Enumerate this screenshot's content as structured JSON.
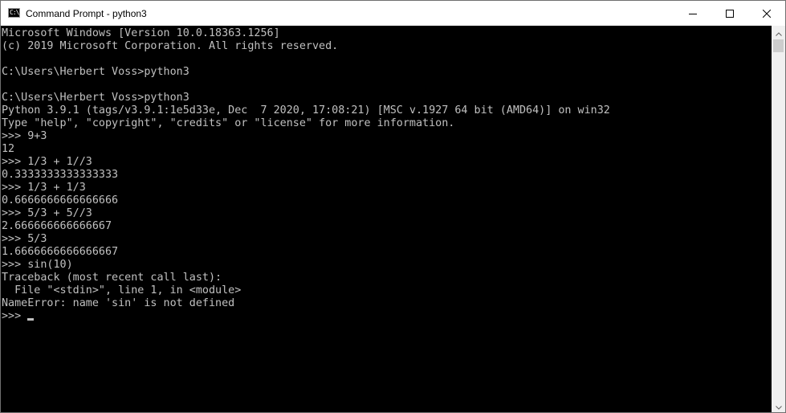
{
  "window": {
    "title": "Command Prompt - python3",
    "icon": "cmd-icon",
    "icon_glyph": "C:\\"
  },
  "controls": {
    "minimize_icon": "minimize-icon",
    "maximize_icon": "maximize-icon",
    "close_icon": "close-icon"
  },
  "console": {
    "lines": [
      "Microsoft Windows [Version 10.0.18363.1256]",
      "(c) 2019 Microsoft Corporation. All rights reserved.",
      "",
      "C:\\Users\\Herbert Voss>python3",
      "",
      "C:\\Users\\Herbert Voss>python3",
      "Python 3.9.1 (tags/v3.9.1:1e5d33e, Dec  7 2020, 17:08:21) [MSC v.1927 64 bit (AMD64)] on win32",
      "Type \"help\", \"copyright\", \"credits\" or \"license\" for more information.",
      ">>> 9+3",
      "12",
      ">>> 1/3 + 1//3",
      "0.3333333333333333",
      ">>> 1/3 + 1/3",
      "0.6666666666666666",
      ">>> 5/3 + 5//3",
      "2.666666666666667",
      ">>> 5/3",
      "1.6666666666666667",
      ">>> sin(10)",
      "Traceback (most recent call last):",
      "  File \"<stdin>\", line 1, in <module>",
      "NameError: name 'sin' is not defined"
    ],
    "prompt": ">>> "
  },
  "colors": {
    "console_background": "#000000",
    "console_text": "#c0c0c0",
    "titlebar_background": "#ffffff",
    "scrollbar_track": "#f0f0f0",
    "scrollbar_thumb": "#cdcdcd"
  }
}
